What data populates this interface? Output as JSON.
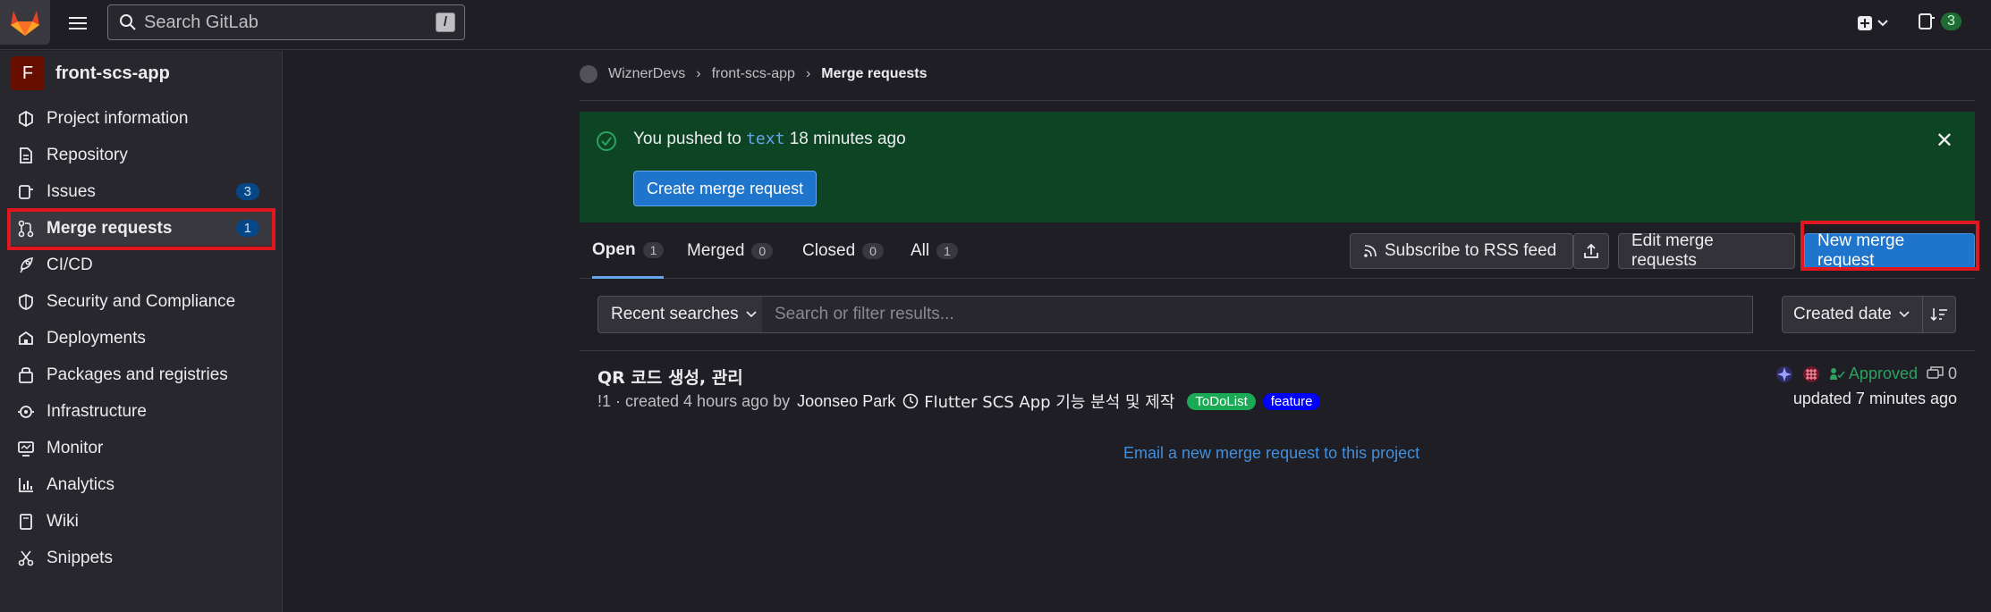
{
  "topbar": {
    "search_placeholder": "Search GitLab",
    "search_shortcut": "/",
    "mr_count": "3"
  },
  "sidebar": {
    "project_initial": "F",
    "project_name": "front-scs-app",
    "items": [
      {
        "label": "Project information",
        "icon": "info-icon"
      },
      {
        "label": "Repository",
        "icon": "doc-icon"
      },
      {
        "label": "Issues",
        "icon": "issues-icon",
        "badge": "3"
      },
      {
        "label": "Merge requests",
        "icon": "merge-icon",
        "badge": "1"
      },
      {
        "label": "CI/CD",
        "icon": "rocket-icon"
      },
      {
        "label": "Security and Compliance",
        "icon": "shield-icon"
      },
      {
        "label": "Deployments",
        "icon": "deploy-icon"
      },
      {
        "label": "Packages and registries",
        "icon": "package-icon"
      },
      {
        "label": "Infrastructure",
        "icon": "cloud-icon"
      },
      {
        "label": "Monitor",
        "icon": "monitor-icon"
      },
      {
        "label": "Analytics",
        "icon": "chart-icon"
      },
      {
        "label": "Wiki",
        "icon": "book-icon"
      },
      {
        "label": "Snippets",
        "icon": "scissors-icon"
      }
    ]
  },
  "breadcrumb": {
    "group": "WiznerDevs",
    "project": "front-scs-app",
    "current": "Merge requests"
  },
  "alert": {
    "prefix": "You pushed to",
    "branch": "text",
    "suffix": "18 minutes ago",
    "button": "Create merge request"
  },
  "tabs": [
    {
      "label": "Open",
      "count": "1"
    },
    {
      "label": "Merged",
      "count": "0"
    },
    {
      "label": "Closed",
      "count": "0"
    },
    {
      "label": "All",
      "count": "1"
    }
  ],
  "actions": {
    "rss": "Subscribe to RSS feed",
    "edit": "Edit merge requests",
    "new": "New merge request"
  },
  "filter": {
    "recent": "Recent searches",
    "placeholder": "Search or filter results...",
    "sort": "Created date"
  },
  "merge_request": {
    "title": "QR 코드 생성, 관리",
    "ref": "!1 · created 4 hours ago by",
    "author": "Joonseo Park",
    "milestone": "Flutter SCS App 기능 분석 및 제작",
    "labels": [
      {
        "text": "ToDoList",
        "color": "#1aaa55"
      },
      {
        "text": "feature",
        "color": "#0000ff"
      }
    ],
    "status": "Approved",
    "comments": "0",
    "updated": "updated 7 minutes ago"
  },
  "email_link": "Email a new merge request to this project",
  "colors": {
    "highlight": "#e0171f",
    "primary": "#1f75cb",
    "alert_bg": "#0d4524"
  }
}
